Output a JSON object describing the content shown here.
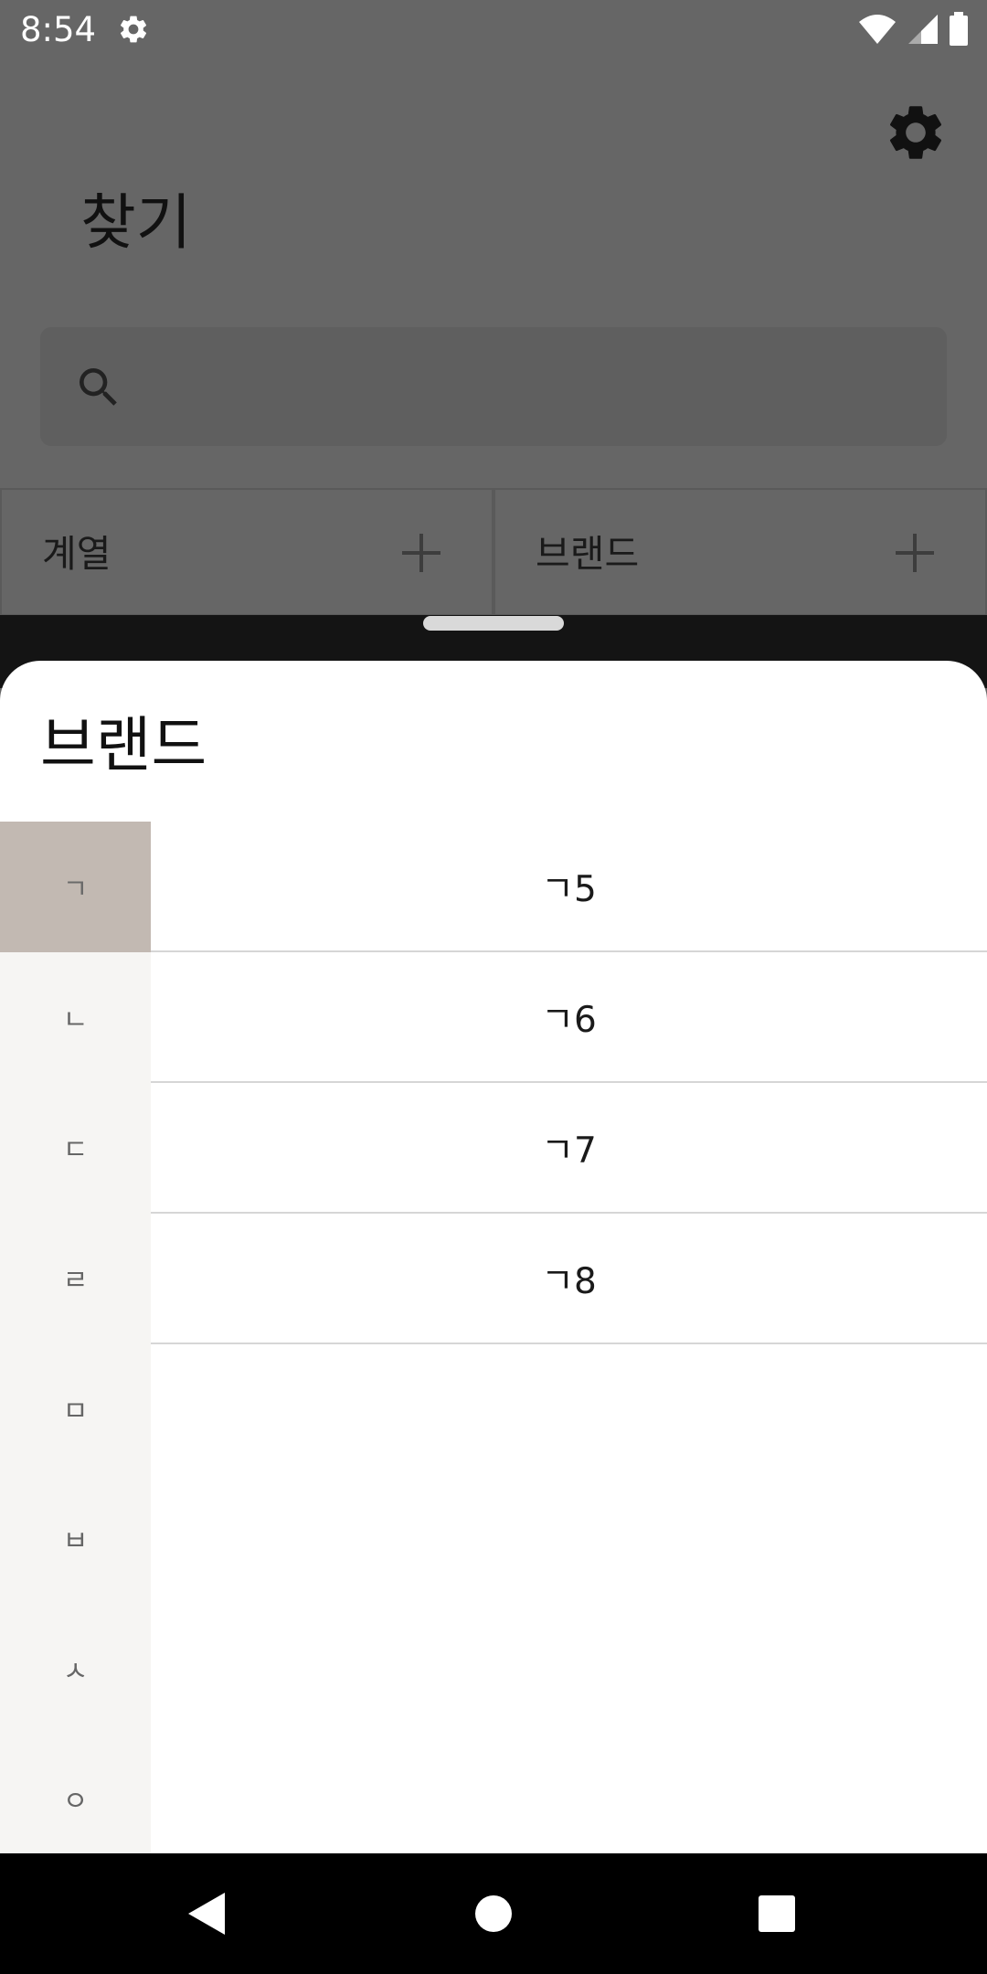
{
  "status_bar": {
    "time": "8:54",
    "icons": [
      "gear-icon",
      "wifi-icon",
      "signal-icon",
      "battery-icon"
    ]
  },
  "background_app": {
    "title": "찾기",
    "search": {
      "value": "",
      "placeholder": ""
    },
    "filters": [
      {
        "label": "계열",
        "icon": "plus-icon"
      },
      {
        "label": "브랜드",
        "icon": "plus-icon"
      }
    ]
  },
  "sheet": {
    "title": "브랜드",
    "index": [
      {
        "label": "ㄱ",
        "selected": true
      },
      {
        "label": "ㄴ",
        "selected": false
      },
      {
        "label": "ㄷ",
        "selected": false
      },
      {
        "label": "ㄹ",
        "selected": false
      },
      {
        "label": "ㅁ",
        "selected": false
      },
      {
        "label": "ㅂ",
        "selected": false
      },
      {
        "label": "ㅅ",
        "selected": false
      },
      {
        "label": "ㅇ",
        "selected": false
      }
    ],
    "items": [
      "ㄱ5",
      "ㄱ6",
      "ㄱ7",
      "ㄱ8"
    ]
  },
  "nav_bar": {
    "buttons": [
      "back-icon",
      "home-icon",
      "recents-icon"
    ]
  },
  "colors": {
    "scrim": "#666666",
    "index_selected": "#c2b9b2",
    "index_background": "#f6f5f3",
    "divider": "#d6d6d6"
  }
}
